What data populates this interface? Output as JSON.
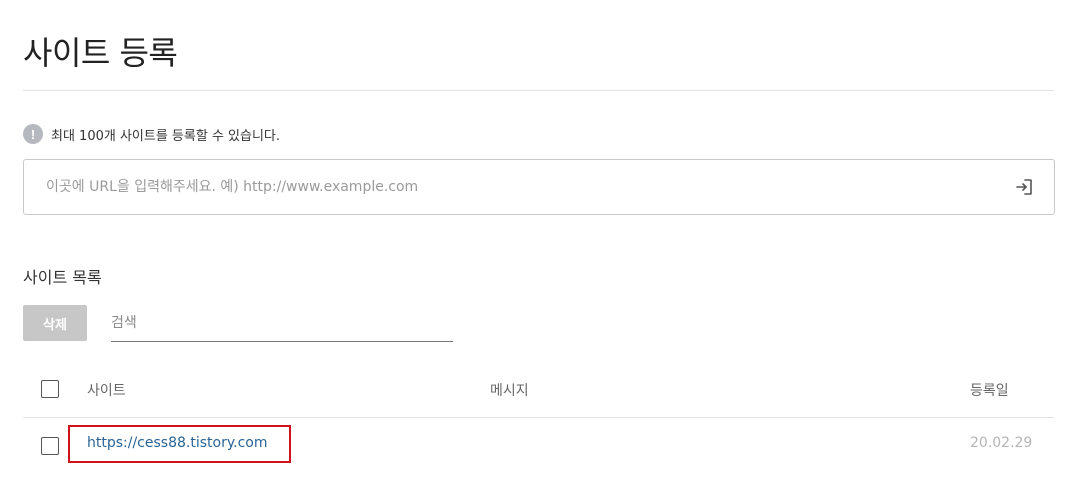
{
  "page": {
    "title": "사이트 등록"
  },
  "notice": {
    "icon": "exclamation-icon",
    "icon_glyph": "!",
    "text": "최대 100개 사이트를 등록할 수 있습니다."
  },
  "url_form": {
    "placeholder": "이곳에 URL을 입력해주세요. 예) http://www.example.com",
    "value": "",
    "submit_icon": "enter-arrow-icon"
  },
  "site_list": {
    "title": "사이트 목록",
    "delete_label": "삭제",
    "search_placeholder": "검색",
    "columns": {
      "site": "사이트",
      "message": "메시지",
      "registered": "등록일"
    },
    "rows": [
      {
        "url": "https://cess88.tistory.com",
        "message": "",
        "date": "20.02.29",
        "checked": false
      }
    ]
  },
  "colors": {
    "highlight": "#d0121b",
    "link": "#2a6496",
    "delete_button": "#c7c7c7"
  }
}
